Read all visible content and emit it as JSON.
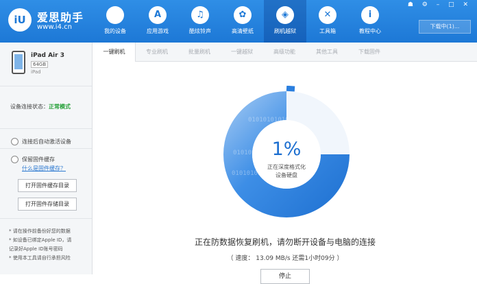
{
  "brand": {
    "logo_text": "iU",
    "name": "爱思助手",
    "url": "www.i4.cn"
  },
  "nav": [
    {
      "label": "我的设备",
      "icon": "apple-icon",
      "glyph": "",
      "active": false
    },
    {
      "label": "应用游戏",
      "icon": "app-store-icon",
      "glyph": "A",
      "active": false
    },
    {
      "label": "酷炫铃声",
      "icon": "bell-icon",
      "glyph": "♫",
      "active": false
    },
    {
      "label": "高清壁纸",
      "icon": "flower-icon",
      "glyph": "✿",
      "active": false
    },
    {
      "label": "刷机越狱",
      "icon": "dropbox-icon",
      "glyph": "◈",
      "active": true
    },
    {
      "label": "工具箱",
      "icon": "tools-icon",
      "glyph": "✕",
      "active": false
    },
    {
      "label": "教程中心",
      "icon": "info-icon",
      "glyph": "i",
      "active": false
    }
  ],
  "window_controls": "☗ ⚙ – □ ✕",
  "download_center": "下载中(1)...",
  "device": {
    "name": "iPad Air 3",
    "capacity": "64GB",
    "type": "iPad"
  },
  "status": {
    "label": "设备连接状态：",
    "value": "正常模式"
  },
  "options": {
    "auto_activate": "连接后自动激活设备",
    "keep_firmware": "保留固件缓存",
    "what_is_cache": "什么是固件缓存？",
    "open_cache_dir": "打开固件缓存目录",
    "open_storage_dir": "打开固件存储目录"
  },
  "notes": [
    "* 请在操作前备份好您的数据",
    "* 如设备已绑定Apple ID，请",
    "  记录好Apple ID账号密码",
    "* 使用本工具请自行承担风险"
  ],
  "tabs": [
    {
      "label": "一键刷机",
      "active": true
    },
    {
      "label": "专业刷机",
      "active": false
    },
    {
      "label": "批量刷机",
      "active": false
    },
    {
      "label": "一键越狱",
      "active": false
    },
    {
      "label": "高级功能",
      "active": false
    },
    {
      "label": "其他工具",
      "active": false
    },
    {
      "label": "下载固件",
      "active": false
    }
  ],
  "progress": {
    "percent_text": "1%",
    "percent_value": 0.01,
    "line1": "正在深度格式化",
    "line2": "设备硬盘",
    "binary_text": "01010101010"
  },
  "warning": "正在防数据恢复刷机，请勿断开设备与电脑的连接",
  "speed": "（ 速度： 13.09 MB/s  还需1小时09分 ）",
  "stop_button": "停止"
}
